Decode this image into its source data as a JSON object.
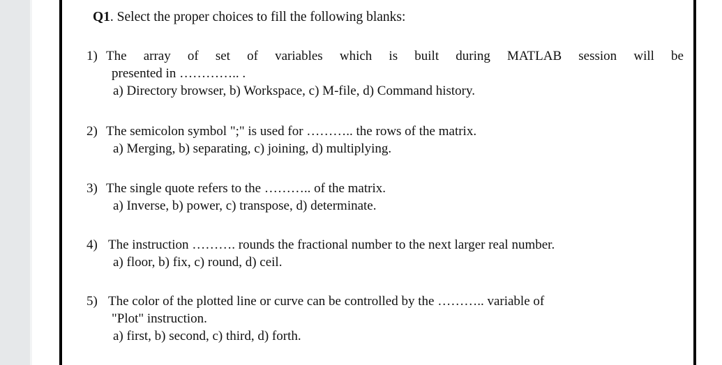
{
  "document": {
    "question_label": "Q1",
    "question_title_rest": ". Select the proper  choices to fill the following  blanks:",
    "items": [
      {
        "marker": "1)",
        "stem_line1": "The array of set of variables which is built during MATLAB   session   will    be",
        "stem_line2": "presented in …………..  .",
        "choices": "a) Directory  browser,   b) Workspace,  c) M-file,   d) Command  history."
      },
      {
        "marker": "2)",
        "stem_line1": "The semicolon symbol \";\" is used for ……….. the  rows of the matrix.",
        "stem_line2": "",
        "choices": "a) Merging,   b) separating,  c) joining,  d) multiplying."
      },
      {
        "marker": "3)",
        "stem_line1": "The single quote refers to the ……….. of the matrix.",
        "stem_line2": "",
        "choices": "a) Inverse,    b) power,   c) transpose,  d) determinate."
      },
      {
        "marker": "4)",
        "stem_line1": "The instruction ………. rounds the fractional number to the next larger real number.",
        "stem_line2": "",
        "choices": "a) floor,   b) fix,   c) round,    d) ceil."
      },
      {
        "marker": "5)",
        "stem_line1": "The color of the plotted line  or curve can be controlled by the ……….. variable of",
        "stem_line2": "\"Plot\" instruction.",
        "choices": "a) first,   b) second,  c) third,   d) forth."
      }
    ]
  },
  "colors": {
    "page_background": "#ffffff",
    "text": "#111111",
    "rule": "#000000",
    "scan_gutter": "#e6e8ea"
  }
}
